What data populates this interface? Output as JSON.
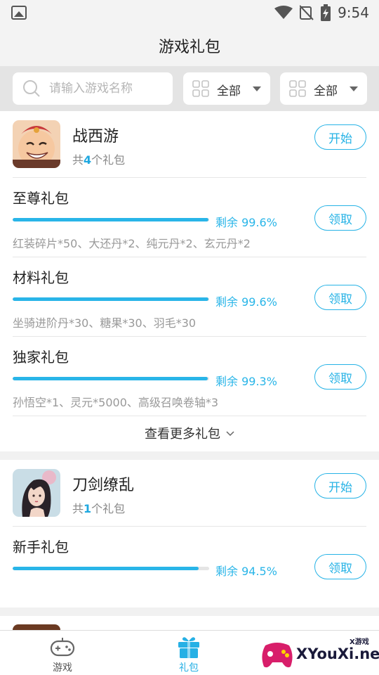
{
  "status_bar": {
    "time": "9:54"
  },
  "header": {
    "title": "游戏礼包"
  },
  "filter": {
    "search_placeholder": "请输入游戏名称",
    "dropdown1": "全部",
    "dropdown2": "全部"
  },
  "games": [
    {
      "name": "战西游",
      "count_prefix": "共",
      "count": "4",
      "count_suffix": "个礼包",
      "action": "开始",
      "packs": [
        {
          "name": "至尊礼包",
          "remain": "剩余 99.6%",
          "progress": 0.996,
          "desc": "红装碎片*50、大还丹*2、纯元丹*2、玄元丹*2",
          "action": "领取"
        },
        {
          "name": "材料礼包",
          "remain": "剩余 99.6%",
          "progress": 0.996,
          "desc": "坐骑进阶丹*30、糖果*30、羽毛*30",
          "action": "领取"
        },
        {
          "name": "独家礼包",
          "remain": "剩余 99.3%",
          "progress": 0.993,
          "desc": "孙悟空*1、灵元*5000、高级召唤卷轴*3",
          "action": "领取"
        }
      ],
      "more": "查看更多礼包"
    },
    {
      "name": "刀剑缭乱",
      "count_prefix": "共",
      "count": "1",
      "count_suffix": "个礼包",
      "action": "开始",
      "packs": [
        {
          "name": "新手礼包",
          "remain": "剩余 94.5%",
          "progress": 0.945,
          "desc": "",
          "action": "领取"
        }
      ]
    }
  ],
  "bottom_nav": [
    {
      "label": "游戏",
      "icon": "gamepad-icon",
      "active": false
    },
    {
      "label": "礼包",
      "icon": "gift-icon",
      "active": true
    }
  ],
  "watermark": {
    "text": "XYouXi.net",
    "small": "X游戏"
  },
  "colors": {
    "accent": "#29b5e8",
    "background": "#f1f1f1",
    "filter_bar": "#e4e4e4"
  }
}
